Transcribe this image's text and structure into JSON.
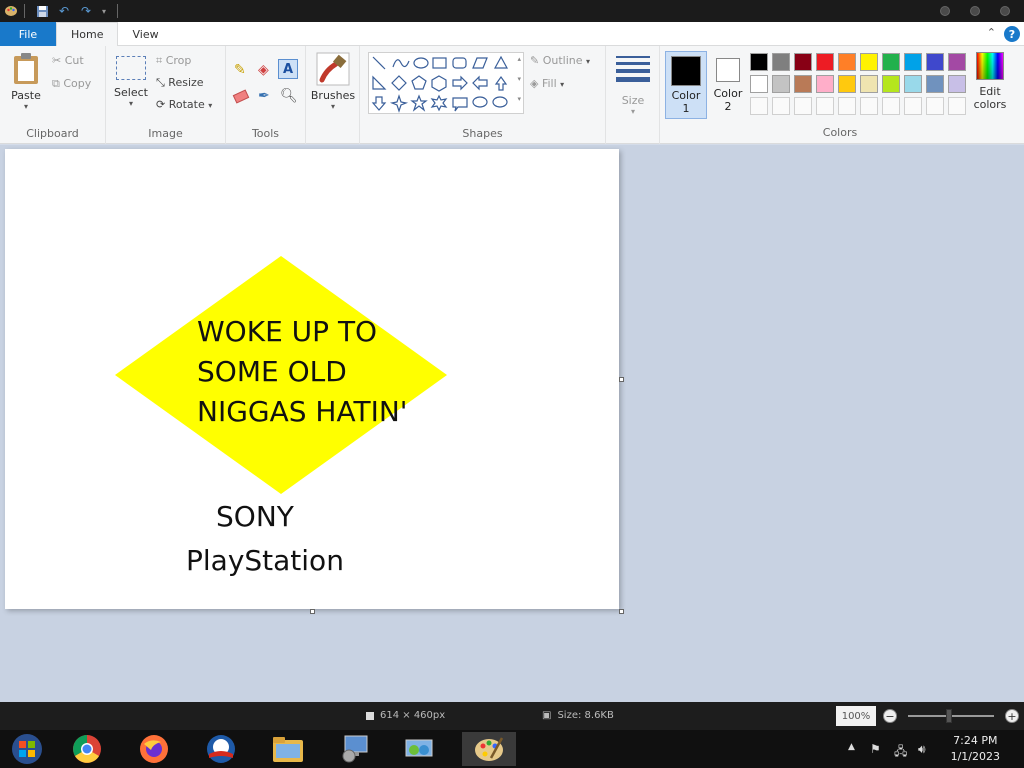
{
  "ribbon": {
    "tabs": {
      "file": "File",
      "home": "Home",
      "view": "View"
    },
    "clipboard": {
      "paste": "Paste",
      "cut": "Cut",
      "copy": "Copy",
      "label": "Clipboard"
    },
    "image": {
      "select": "Select",
      "crop": "Crop",
      "resize": "Resize",
      "rotate": "Rotate",
      "label": "Image"
    },
    "tools": {
      "label": "Tools"
    },
    "brushes": {
      "label": "Brushes"
    },
    "shapes": {
      "outline": "Outline",
      "fill": "Fill",
      "label": "Shapes"
    },
    "size": {
      "label": "Size"
    },
    "color1": {
      "label": "Color",
      "num": "1",
      "color": "#000000"
    },
    "color2": {
      "label": "Color",
      "num": "2",
      "color": "#ffffff"
    },
    "colors": {
      "label": "Colors",
      "edit_label": "Edit",
      "edit_label2": "colors",
      "row1": [
        "#000000",
        "#7f7f7f",
        "#880015",
        "#ed1c24",
        "#ff7f27",
        "#fff200",
        "#22b14c",
        "#00a2e8",
        "#3f48cc",
        "#a349a4"
      ],
      "row2": [
        "#ffffff",
        "#c3c3c3",
        "#b97a57",
        "#ffaec9",
        "#ffc90e",
        "#efe4b0",
        "#b5e61d",
        "#99d9ea",
        "#7092be",
        "#c8bfe7"
      ]
    },
    "help": "?"
  },
  "canvas": {
    "line1": "WOKE UP TO",
    "line2": "SOME OLD",
    "line3": "NIGGAS HATIN'",
    "line4": "SONY",
    "line5": "PlayStation",
    "diamond_color": "#ffff00"
  },
  "status": {
    "dimensions": "614 × 460px",
    "size": "Size: 8.6KB",
    "zoom": "100%"
  },
  "taskbar": {
    "time": "7:24 PM",
    "date": "1/1/2023"
  }
}
